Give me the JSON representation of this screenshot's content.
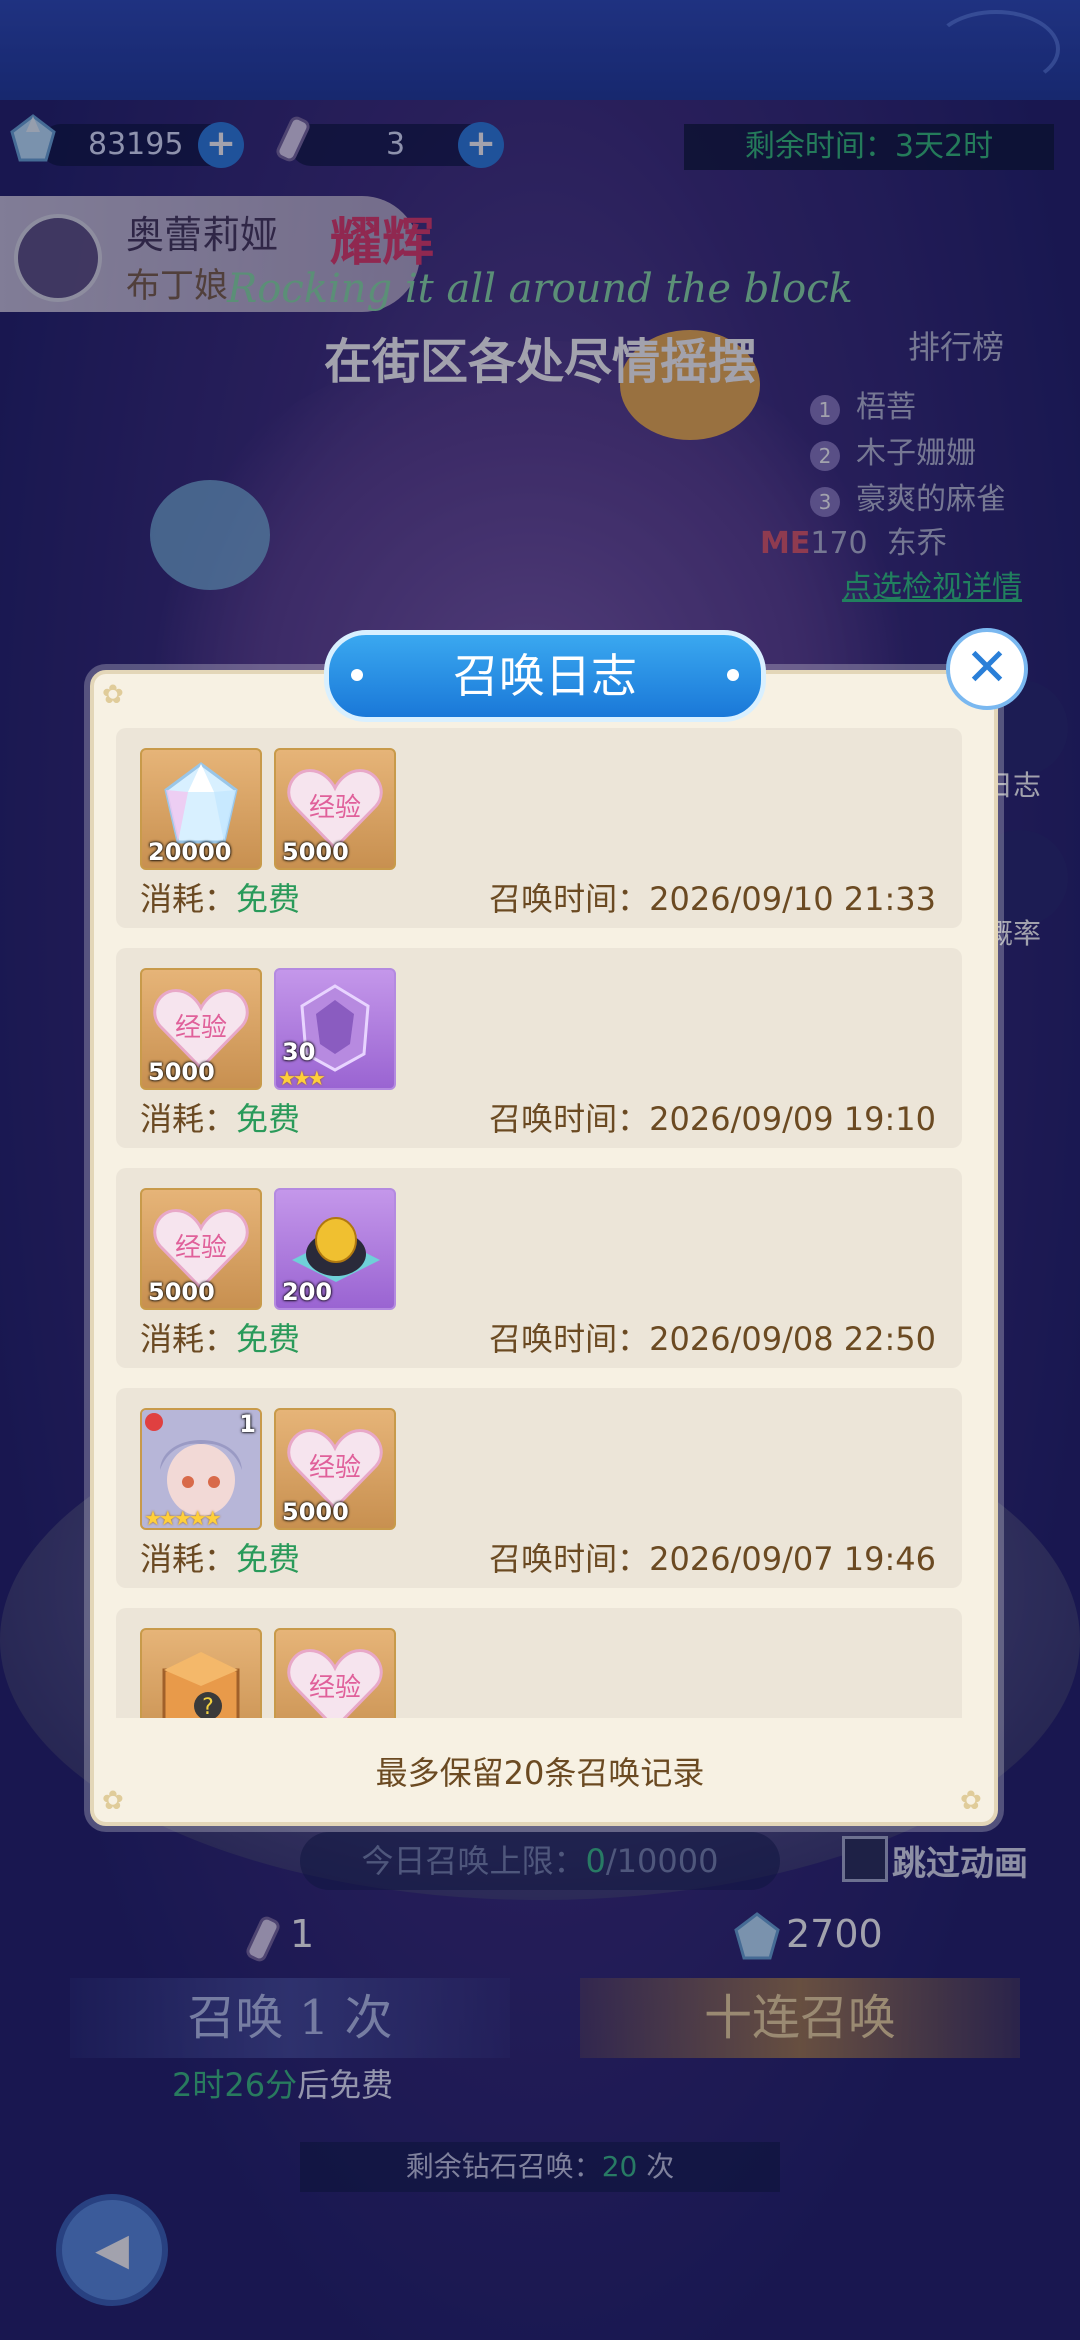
{
  "resources": {
    "diamonds": "83195",
    "tickets": "3",
    "time_left": "剩余时间：3天2时"
  },
  "character": {
    "name": "奥蕾莉娅",
    "subtitle": "布丁娘",
    "tag": "耀辉"
  },
  "song": {
    "english": "Rocking it all around the block",
    "chinese": "在街区各处尽情摇摆"
  },
  "ranking": {
    "title": "排行榜",
    "entries": [
      {
        "rank": "1",
        "name": "梧菩"
      },
      {
        "rank": "2",
        "name": "木子姗姗"
      },
      {
        "rank": "3",
        "name": "豪爽的麻雀"
      }
    ],
    "me_label": "ME",
    "me_rank": "170",
    "me_name": "东乔",
    "details_link": "点选检视详情"
  },
  "side_buttons": {
    "log": "日志",
    "rate": "概率"
  },
  "modal": {
    "title": "召唤日志",
    "close_icon": "close-icon",
    "footer": "最多保留20条召唤记录",
    "cost_label": "消耗：",
    "time_label": "召唤时间：",
    "entries": [
      {
        "items": [
          {
            "icon": "diamond-icon",
            "qty": "20000"
          },
          {
            "icon": "exp-heart-icon",
            "qty": "5000"
          }
        ],
        "cost": "免费",
        "time": "2026/09/10 21:33"
      },
      {
        "items": [
          {
            "icon": "exp-heart-icon",
            "qty": "5000"
          },
          {
            "icon": "purple-crystal-icon",
            "qty": "30",
            "stars": "★★★"
          }
        ],
        "cost": "免费",
        "time": "2026/09/09 19:10"
      },
      {
        "items": [
          {
            "icon": "exp-heart-icon",
            "qty": "5000"
          },
          {
            "icon": "golden-egg-icon",
            "qty": "200"
          }
        ],
        "cost": "免费",
        "time": "2026/09/08 22:50"
      },
      {
        "items": [
          {
            "icon": "character-portrait-icon",
            "qty": "1",
            "stars": "★★★★★"
          },
          {
            "icon": "exp-heart-icon",
            "qty": "5000"
          }
        ],
        "cost": "免费",
        "time": "2026/09/07 19:46"
      },
      {
        "items": [
          {
            "icon": "mystery-box-icon",
            "qty": ""
          },
          {
            "icon": "exp-heart-icon",
            "qty": ""
          }
        ],
        "cost": "",
        "time": ""
      }
    ],
    "exp_text": "经验"
  },
  "bottom": {
    "limit_prefix": "今日召唤上限：",
    "limit_used": "0",
    "limit_total": "/10000",
    "skip_label": "跳过动画",
    "ticket_cost": "1",
    "diamond_cost": "2700",
    "summon_one": "召唤 1 次",
    "summon_ten": "十连召唤",
    "free_time": "2时26分",
    "free_suffix": "后免费",
    "remain_prefix": "剩余钻石召唤：",
    "remain_count": "20",
    "remain_suffix": " 次"
  },
  "colors": {
    "accent_green": "#2a9a5a",
    "modal_bg": "#f7f1e3",
    "title_blue": "#1a78d8",
    "text_brown": "#6b4a22"
  }
}
